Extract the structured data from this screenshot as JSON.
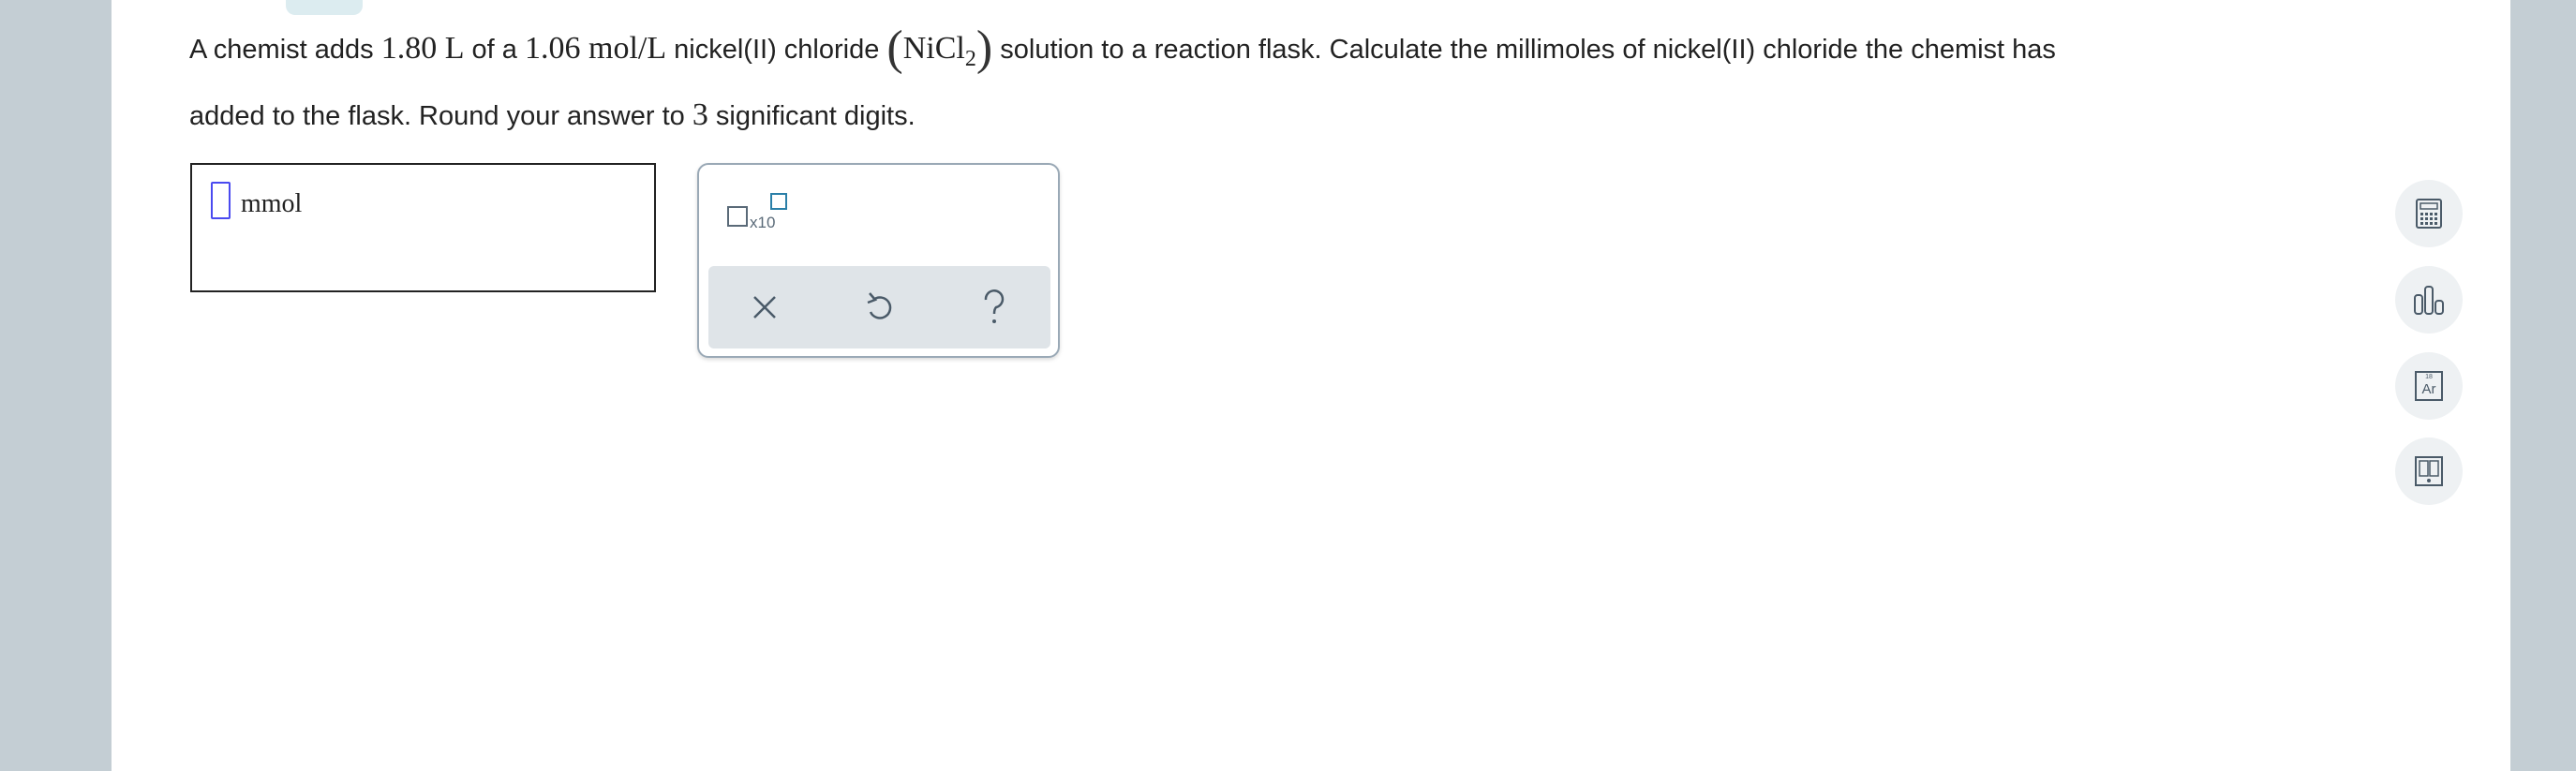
{
  "question": {
    "part1": "A chemist adds ",
    "volume": "1.80 L",
    "part2": " of a ",
    "concentration": "1.06 mol/L",
    "part3": " nickel(II) chloride ",
    "formula_base": "NiCl",
    "formula_sub": "2",
    "part4": " solution to a reaction flask. Calculate the millimoles of nickel(II) chloride the chemist has",
    "part5": "added to the flask. Round your answer to ",
    "sig_figs": "3",
    "part6": " significant digits."
  },
  "answer": {
    "value": "",
    "unit": "mmol"
  },
  "palette": {
    "sci_notation_label": "x10"
  },
  "side_tools": {
    "periodic_table_symbol": "Ar",
    "periodic_table_number": "18"
  },
  "colors": {
    "page_bg": "#ffffff",
    "frame_bg": "#c4ced4",
    "cursor": "#4a4af0",
    "icon": "#4a5a68"
  }
}
